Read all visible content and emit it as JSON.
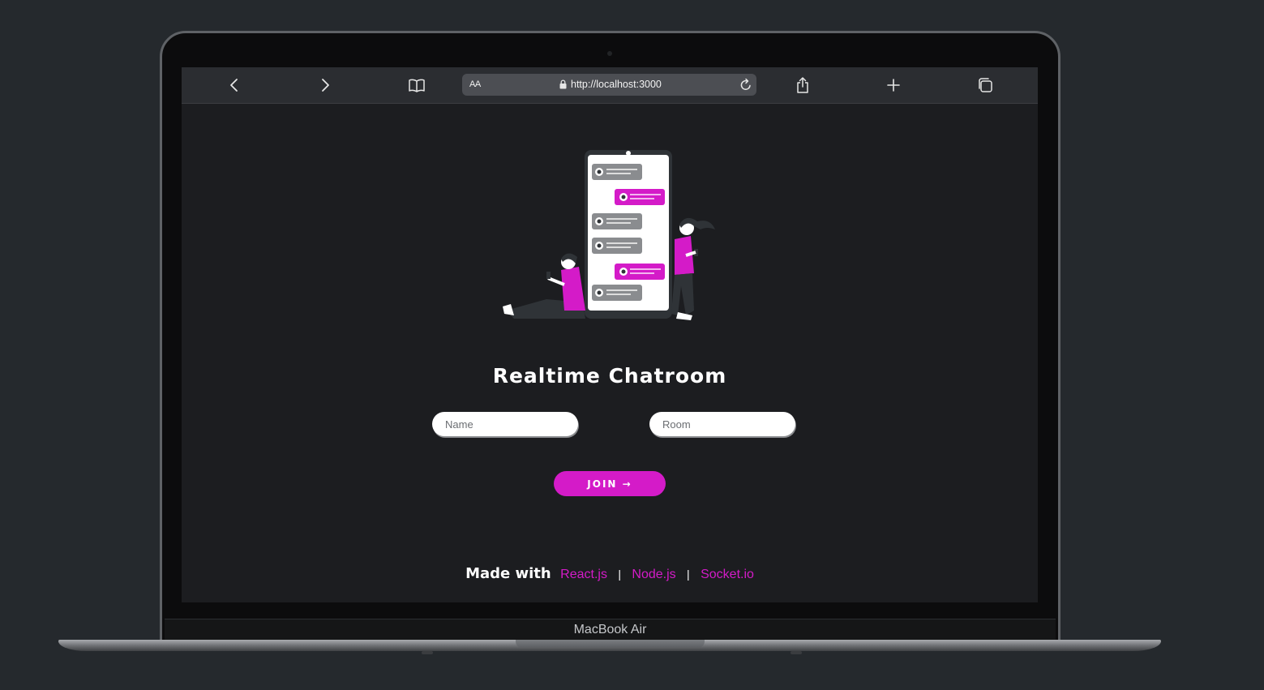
{
  "device": {
    "label": "MacBook Air"
  },
  "browser": {
    "url": "http://localhost:3000",
    "text_size_label": "AA"
  },
  "page": {
    "title": "Realtime Chatroom",
    "name_placeholder": "Name",
    "room_placeholder": "Room",
    "join_label": "JOIN →",
    "footer": {
      "made_with": "Made with",
      "links": [
        "React.js",
        "Node.js",
        "Socket.io"
      ],
      "separator": "|"
    }
  },
  "colors": {
    "accent": "#d41bc8",
    "page_bg": "#1c1d20",
    "toolbar_bg": "#2b2d31",
    "outer_bg": "#25292d"
  },
  "icons": [
    "chevron-left-icon",
    "chevron-right-icon",
    "book-icon",
    "lock-icon",
    "reload-icon",
    "share-icon",
    "plus-icon",
    "tabs-icon"
  ]
}
